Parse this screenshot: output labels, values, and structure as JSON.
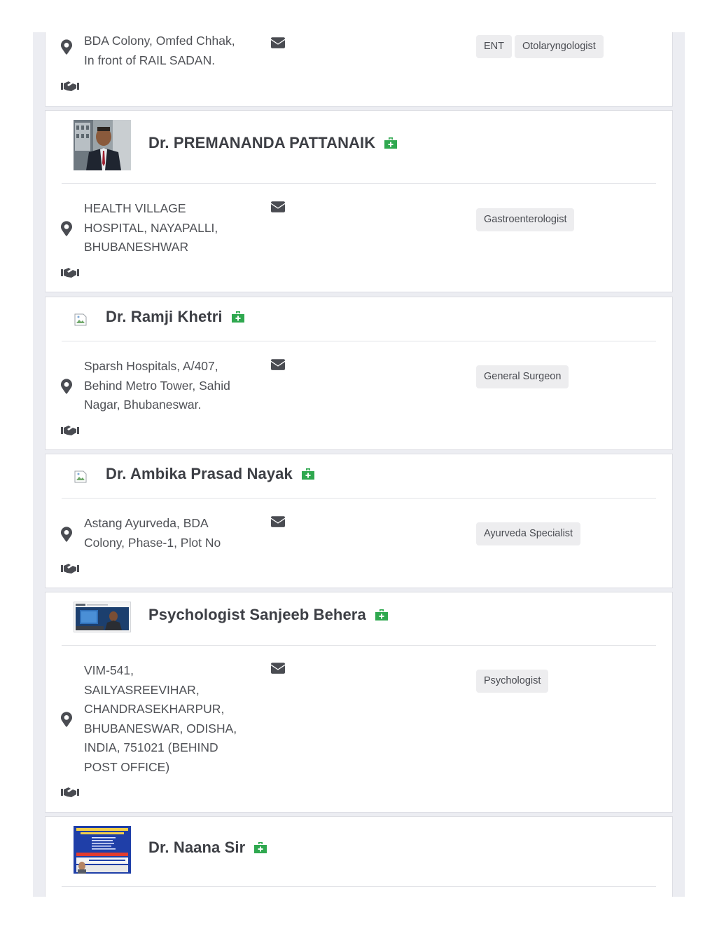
{
  "listings": [
    {
      "name": "",
      "address": [
        "BDA Colony, Omfed Chhak,",
        "In front of RAIL SADAN."
      ],
      "tags": [
        "ENT",
        "Otolaryngologist"
      ],
      "photo": "none"
    },
    {
      "name": "Dr. PREMANANDA PATTANAIK",
      "address": [
        "HEALTH VILLAGE",
        "HOSPITAL, NAYAPALLI,",
        "BHUBANESHWAR"
      ],
      "tags": [
        "Gastroenterologist"
      ],
      "photo": "portrait"
    },
    {
      "name": "Dr. Ramji Khetri",
      "address": [
        "Sparsh Hospitals, A/407,",
        "Behind Metro Tower, Sahid",
        "Nagar, Bhubaneswar."
      ],
      "tags": [
        "General Surgeon"
      ],
      "photo": "broken"
    },
    {
      "name": "Dr. Ambika Prasad Nayak",
      "address": [
        "Astang Ayurveda, BDA",
        "Colony, Phase-1, Plot No"
      ],
      "tags": [
        "Ayurveda Specialist"
      ],
      "photo": "broken"
    },
    {
      "name": "Psychologist Sanjeeb Behera",
      "address": [
        "VIM-541,",
        "SAILYASREEVIHAR,",
        "CHANDRASEKHARPUR,",
        "BHUBANESWAR, ODISHA,",
        "INDIA, 751021 (BEHIND",
        "POST OFFICE)"
      ],
      "tags": [
        "Psychologist"
      ],
      "photo": "banner"
    },
    {
      "name": "Dr. Naana Sir",
      "address": [],
      "tags": [],
      "photo": "poster"
    }
  ],
  "colors": {
    "medkit": "#2fa84f",
    "icon": "#4a4c52",
    "page_bg": "#ecedf2",
    "tag_bg": "#ededef"
  },
  "icons": {
    "location": "map-marker-icon",
    "email": "envelope-icon",
    "handshake": "handshake-icon",
    "specialty": "medkit-icon"
  }
}
